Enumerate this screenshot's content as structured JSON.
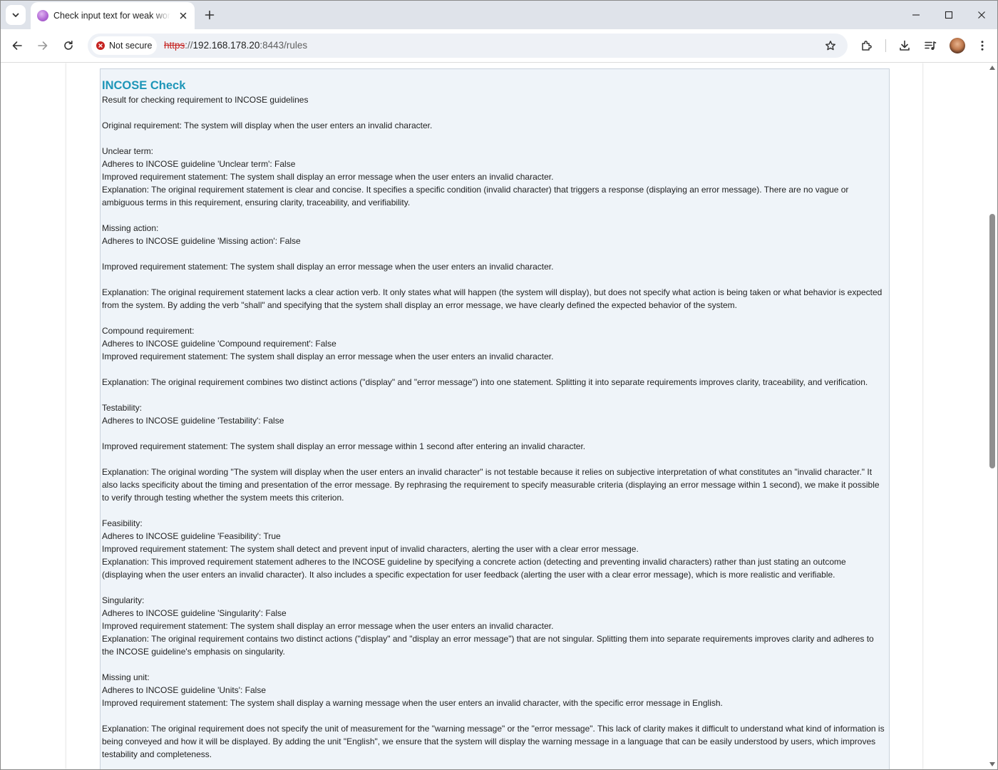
{
  "browser": {
    "tab": {
      "title": "Check input text for weak words",
      "favicon": "app-favicon-icon"
    },
    "window_controls": [
      "minimize-icon",
      "maximize-icon",
      "close-icon"
    ],
    "nav": {
      "back": "back-arrow-icon",
      "forward": "forward-arrow-icon",
      "reload": "reload-icon"
    },
    "security_label": "Not secure",
    "url": {
      "scheme": "https",
      "sep": "://",
      "host": "192.168.178.20",
      "rest": ":8443/rules"
    },
    "toolbar_icons": [
      "star-icon",
      "extensions-icon",
      "download-icon",
      "media-control-icon",
      "profile-avatar",
      "kebab-menu-icon"
    ],
    "colors": {
      "tabstrip": "#dfe3ea",
      "not_secure": "#c5221f",
      "panel_bg": "#eff4f9",
      "title_color": "#1e96b8"
    }
  },
  "result": {
    "title": "INCOSE Check",
    "text": "Result for checking requirement to INCOSE guidelines\n\nOriginal requirement: The system will display when the user enters an invalid character.\n\nUnclear term:\nAdheres to INCOSE guideline 'Unclear term': False\nImproved requirement statement: The system shall display an error message when the user enters an invalid character.\nExplanation: The original requirement statement is clear and concise. It specifies a specific condition (invalid character) that triggers a response (displaying an error message). There are no vague or ambiguous terms in this requirement, ensuring clarity, traceability, and verifiability.\n\nMissing action:\nAdheres to INCOSE guideline 'Missing action': False\n\nImproved requirement statement: The system shall display an error message when the user enters an invalid character.\n\nExplanation: The original requirement statement lacks a clear action verb. It only states what will happen (the system will display), but does not specify what action is being taken or what behavior is expected from the system. By adding the verb \"shall\" and specifying that the system shall display an error message, we have clearly defined the expected behavior of the system.\n\nCompound requirement:\nAdheres to INCOSE guideline 'Compound requirement': False\nImproved requirement statement: The system shall display an error message when the user enters an invalid character.\n\nExplanation: The original requirement combines two distinct actions (\"display\" and \"error message\") into one statement. Splitting it into separate requirements improves clarity, traceability, and verification.\n\nTestability:\nAdheres to INCOSE guideline 'Testability': False\n\nImproved requirement statement: The system shall display an error message within 1 second after entering an invalid character.\n\nExplanation: The original wording \"The system will display when the user enters an invalid character\" is not testable because it relies on subjective interpretation of what constitutes an \"invalid character.\" It also lacks specificity about the timing and presentation of the error message. By rephrasing the requirement to specify measurable criteria (displaying an error message within 1 second), we make it possible to verify through testing whether the system meets this criterion.\n\nFeasibility:\nAdheres to INCOSE guideline 'Feasibility': True\nImproved requirement statement: The system shall detect and prevent input of invalid characters, alerting the user with a clear error message.\nExplanation: This improved requirement statement adheres to the INCOSE guideline by specifying a concrete action (detecting and preventing invalid characters) rather than just stating an outcome (displaying when the user enters an invalid character). It also includes a specific expectation for user feedback (alerting the user with a clear error message), which is more realistic and verifiable.\n\nSingularity:\nAdheres to INCOSE guideline 'Singularity': False\nImproved requirement statement: The system shall display an error message when the user enters an invalid character.\nExplanation: The original requirement contains two distinct actions (\"display\" and \"display an error message\") that are not singular. Splitting them into separate requirements improves clarity and adheres to the INCOSE guideline's emphasis on singularity.\n\nMissing unit:\nAdheres to INCOSE guideline 'Units': False\nImproved requirement statement: The system shall display a warning message when the user enters an invalid character, with the specific error message in English.\n\nExplanation: The original requirement does not specify the unit of measurement for the \"warning message\" or the \"error message\". This lack of clarity makes it difficult to understand what kind of information is being conveyed and how it will be displayed. By adding the unit \"English\", we ensure that the system will display the warning message in a language that can be easily understood by users, which improves testability and completeness."
  }
}
